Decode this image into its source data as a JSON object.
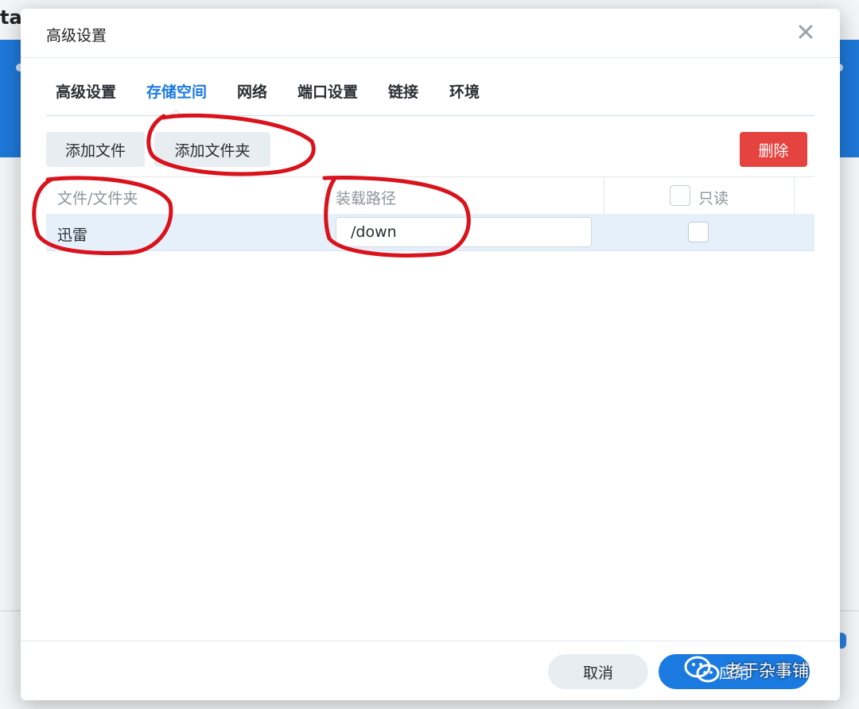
{
  "background": {
    "title_fragment": "tar"
  },
  "dialog": {
    "title": "高级设置",
    "close_icon": "close-icon"
  },
  "tabs": [
    {
      "label": "高级设置",
      "active": false
    },
    {
      "label": "存储空间",
      "active": true
    },
    {
      "label": "网络",
      "active": false
    },
    {
      "label": "端口设置",
      "active": false
    },
    {
      "label": "链接",
      "active": false
    },
    {
      "label": "环境",
      "active": false
    }
  ],
  "toolbar": {
    "add_file_label": "添加文件",
    "add_folder_label": "添加文件夹",
    "delete_label": "删除"
  },
  "table": {
    "headers": {
      "file": "文件/文件夹",
      "mount_path": "装载路径",
      "readonly": "只读"
    },
    "rows": [
      {
        "name": "迅雷",
        "mount_path": "/down",
        "readonly": false
      }
    ]
  },
  "footer": {
    "cancel_label": "取消",
    "apply_label": "应用"
  },
  "watermark": {
    "text": "老于杂事铺",
    "icon": "wechat-icon"
  },
  "colors": {
    "accent": "#1a7ae0",
    "danger": "#e4433f",
    "annotation": "#d9121b"
  }
}
